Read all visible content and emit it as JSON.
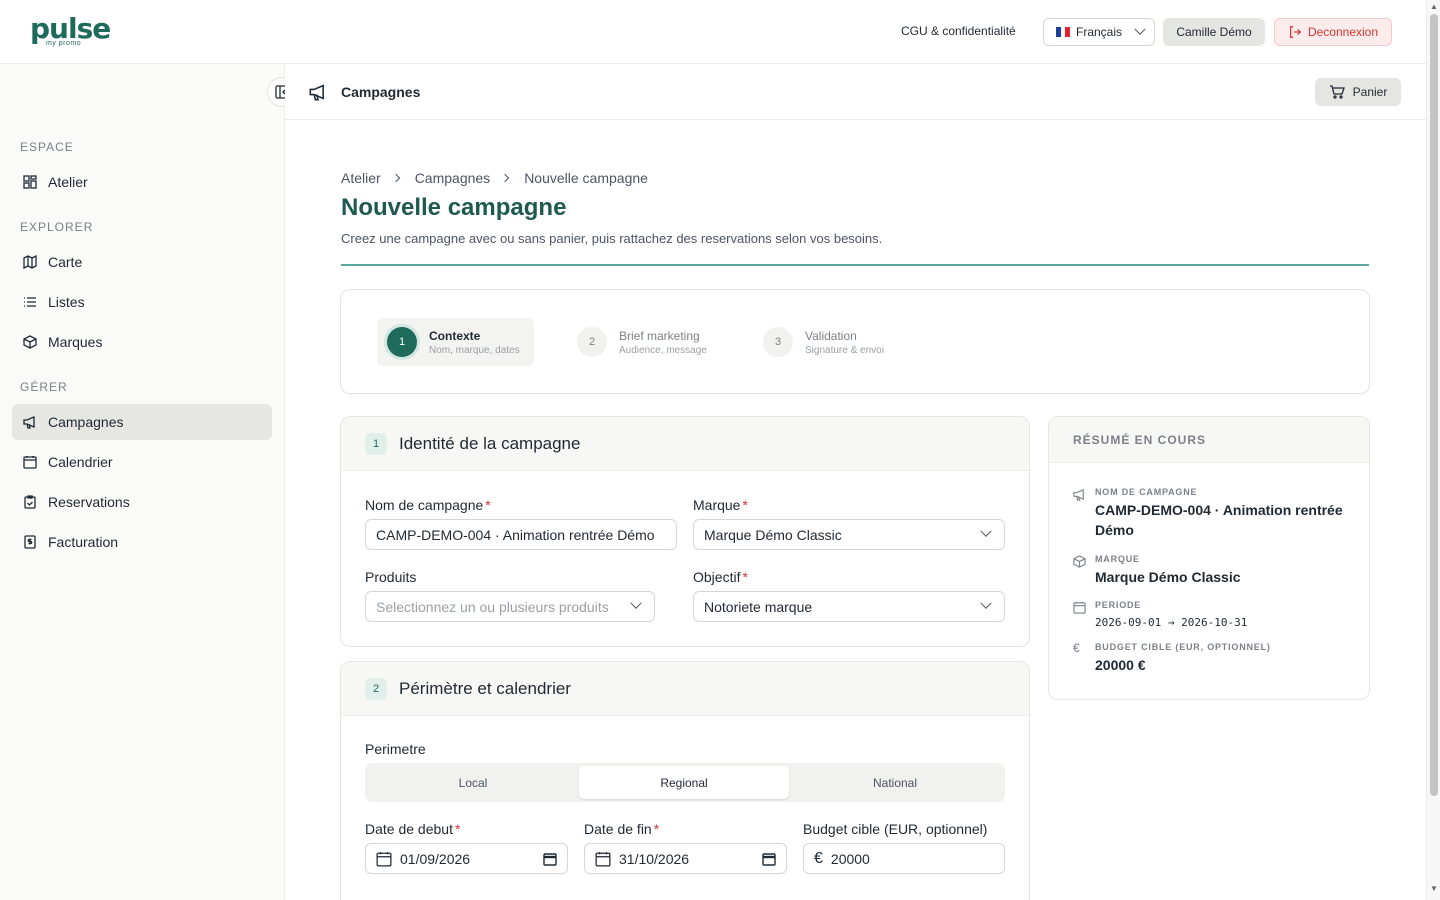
{
  "topbar": {
    "logo_text": "pulse",
    "logo_sub": "my promo",
    "terms_link": "CGU & confidentialité",
    "language": "Français",
    "user": "Camille Démo",
    "logout": "Deconnexion"
  },
  "sidebar": {
    "section_espace": "ESPACE",
    "section_explorer": "EXPLORER",
    "section_gerer": "GÉRER",
    "items": [
      {
        "label": "Atelier",
        "icon": "grid-icon"
      },
      {
        "label": "Carte",
        "icon": "map-icon"
      },
      {
        "label": "Listes",
        "icon": "list-icon"
      },
      {
        "label": "Marques",
        "icon": "box-icon"
      },
      {
        "label": "Campagnes",
        "icon": "megaphone-icon",
        "active": true
      },
      {
        "label": "Calendrier",
        "icon": "calendar-icon"
      },
      {
        "label": "Reservations",
        "icon": "clipboard-icon"
      },
      {
        "label": "Facturation",
        "icon": "invoice-icon"
      }
    ]
  },
  "subheader": {
    "title": "Campagnes",
    "cart_label": "Panier"
  },
  "breadcrumb": [
    "Atelier",
    "Campagnes",
    "Nouvelle campagne"
  ],
  "page": {
    "title": "Nouvelle campagne",
    "subtitle": "Creez une campagne avec ou sans panier, puis rattachez des reservations selon vos besoins."
  },
  "steps": [
    {
      "num": "1",
      "title": "Contexte",
      "desc": "Nom, marque, dates",
      "active": true
    },
    {
      "num": "2",
      "title": "Brief marketing",
      "desc": "Audience, message"
    },
    {
      "num": "3",
      "title": "Validation",
      "desc": "Signature & envoi"
    }
  ],
  "identity": {
    "num": "1",
    "title": "Identité de la campagne",
    "name_label": "Nom de campagne",
    "name_value": "CAMP-DEMO-004 · Animation rentrée Démo",
    "brand_label": "Marque",
    "brand_value": "Marque Démo Classic",
    "products_label": "Produits",
    "products_placeholder": "Selectionnez un ou plusieurs produits",
    "objective_label": "Objectif",
    "objective_value": "Notoriete marque"
  },
  "scope": {
    "num": "2",
    "title": "Périmètre et calendrier",
    "perimeter_label": "Perimetre",
    "options": [
      "Local",
      "Regional",
      "National"
    ],
    "selected": "Regional",
    "start_label": "Date de debut",
    "start_value": "01/09/2026",
    "end_label": "Date de fin",
    "end_value": "31/10/2026",
    "budget_label": "Budget cible (EUR, optionnel)",
    "budget_value": "20000"
  },
  "summary": {
    "title": "RÉSUMÉ EN COURS",
    "name_label": "NOM DE CAMPAGNE",
    "name_value": "CAMP-DEMO-004 · Animation rentrée Démo",
    "brand_label": "MARQUE",
    "brand_value": "Marque Démo Classic",
    "period_label": "PERIODE",
    "period_value": "2026-09-01 → 2026-10-31",
    "budget_label": "BUDGET CIBLE (EUR, OPTIONNEL)",
    "budget_value": "20000 €"
  },
  "colors": {
    "brand": "#1e6b5c",
    "danger": "#d83434",
    "accent_line": "#5aa89a"
  }
}
